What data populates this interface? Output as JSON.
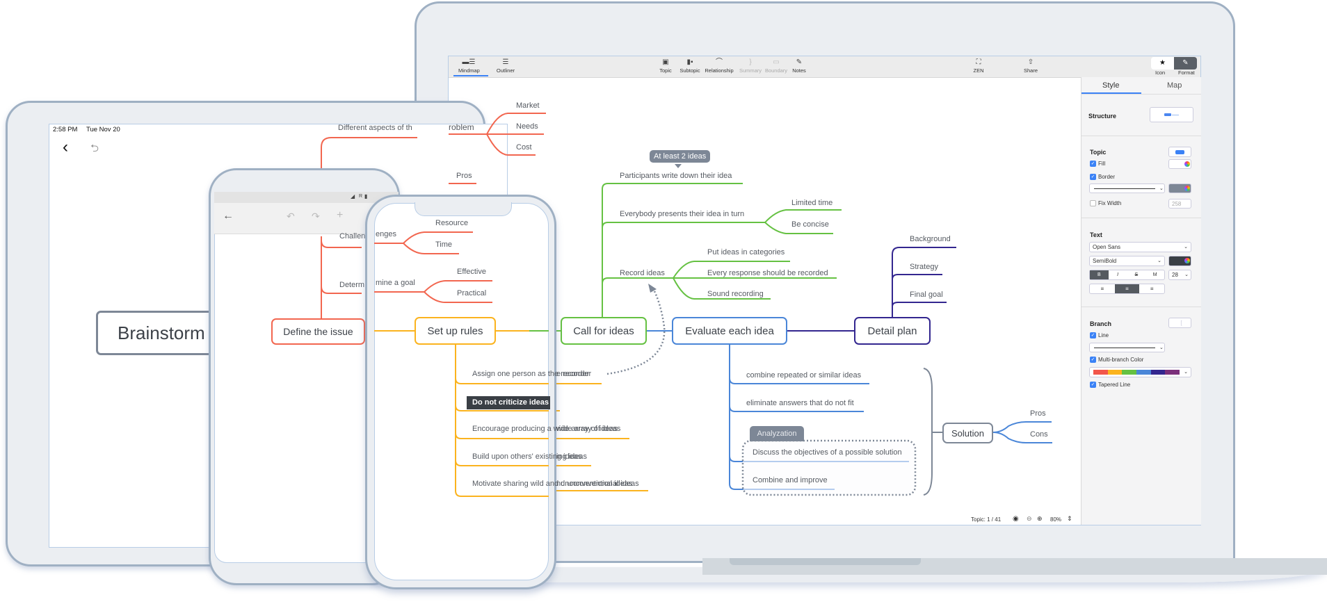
{
  "colors": {
    "red": "#f2664f",
    "orange": "#fbb31e",
    "green": "#65c142",
    "blue": "#4a86d8",
    "indigo": "#33268f",
    "gray": "#7d8796",
    "accent": "#3b82f6"
  },
  "laptop": {
    "toolbar": {
      "left": [
        {
          "icon": "mindmap-icon",
          "label": "Mindmap",
          "active": true
        },
        {
          "icon": "outliner-icon",
          "label": "Outliner"
        }
      ],
      "center": [
        {
          "icon": "topic-icon",
          "label": "Topic"
        },
        {
          "icon": "subtopic-icon",
          "label": "Subtopic"
        },
        {
          "icon": "relationship-icon",
          "label": "Relationship"
        },
        {
          "icon": "summary-icon",
          "label": "Summary",
          "disabled": true
        },
        {
          "icon": "boundary-icon",
          "label": "Boundary",
          "disabled": true
        },
        {
          "icon": "notes-icon",
          "label": "Notes"
        }
      ],
      "right": [
        {
          "icon": "zen-icon",
          "label": "ZEN"
        },
        {
          "icon": "share-icon",
          "label": "Share"
        }
      ],
      "toggle": [
        {
          "icon": "star-icon",
          "label": "Icon"
        },
        {
          "icon": "brush-icon",
          "label": "Format",
          "active": true
        }
      ]
    },
    "panel": {
      "tabs": [
        "Style",
        "Map"
      ],
      "active_tab": "Style",
      "structure_label": "Structure",
      "topic": {
        "title": "Topic",
        "fill_label": "Fill",
        "fill_checked": true,
        "border_label": "Border",
        "border_checked": true,
        "fix_width_label": "Fix Width",
        "fix_width_checked": false,
        "fix_width_value": "258"
      },
      "text": {
        "title": "Text",
        "font": "Open Sans",
        "weight": "SemiBold",
        "style_buttons": [
          "B",
          "I",
          "S",
          "M"
        ],
        "size": "28"
      },
      "branch": {
        "title": "Branch",
        "line_label": "Line",
        "line_checked": true,
        "multi_label": "Multi-branch Color",
        "multi_checked": true,
        "palette": [
          "#f2564a",
          "#fbb31e",
          "#65c142",
          "#4a86d8",
          "#33268f",
          "#7b2f7b"
        ],
        "tapered_label": "Tapered Line",
        "tapered_checked": true
      }
    },
    "status": {
      "topic_count": "Topic: 1 / 41",
      "zoom": "80%"
    },
    "map": {
      "problem": "roblem",
      "problem_children": [
        "Market",
        "Needs",
        "Cost"
      ],
      "pros_left": "Pros",
      "call_for_ideas": "Call for ideas",
      "callout": "At least 2 ideas",
      "cfi_children": [
        "Participants write down their idea",
        "Everybody presents their idea in turn",
        "Record ideas"
      ],
      "turn_children": [
        "Limited time",
        "Be concise"
      ],
      "record_children": [
        "Put ideas in categories",
        "Every response should be recorded",
        "Sound recording"
      ],
      "evaluate": "Evaluate each idea",
      "evaluate_children": [
        "combine repeated or similar ideas",
        "eliminate answers that do not fit",
        "Discuss the objectives of a possible solution",
        "Combine and improve"
      ],
      "boundary_label": "Analyzation",
      "solution": "Solution",
      "solution_children": [
        "Pros",
        "Cons"
      ],
      "detail_plan": "Detail plan",
      "detail_children": [
        "Background",
        "Strategy",
        "Final goal"
      ]
    }
  },
  "tablet": {
    "time": "2:58 PM",
    "date": "Tue Nov 20",
    "root": "Brainstorming",
    "define": "Define the issue",
    "define_children": [
      "Different aspects of th",
      "Challenges",
      "Determine a goal"
    ],
    "challenges_label": "Challen"
  },
  "phone1": {
    "status": "R",
    "define_label": "Define the issue"
  },
  "phone2": {
    "challenges_tail": "enges",
    "challenges_children": [
      "Resource",
      "Time"
    ],
    "goal_tail": "mine a goal",
    "goal_children": [
      "Effective",
      "Practical"
    ],
    "setup": "Set up rules",
    "rules": [
      "Assign one person as the recorder",
      "Do not criticize ideas",
      "Encourage producing a wide array of ideas",
      "Build upon others' existing ideas",
      "Motivate sharing wild and unconventional ideas"
    ]
  },
  "visible_fragments": {
    "tablet_determine": "Determ",
    "goal_phone2": "mine a goal",
    "assign_left": "Assign one person as",
    "assign_right": "e recorder",
    "encourage_left": "Encourage producing",
    "encourage_right": "wide array of ideas",
    "build_left": "Build upon others' exi",
    "build_right": "ing ideas",
    "motivate_left": "Motivate sharing wild",
    "motivate_right": "nd unconventional ideas",
    "brain_left": "Brainstorm",
    "brain_right": "ing",
    "define_left": "Define the issue",
    "define_right": "e"
  }
}
